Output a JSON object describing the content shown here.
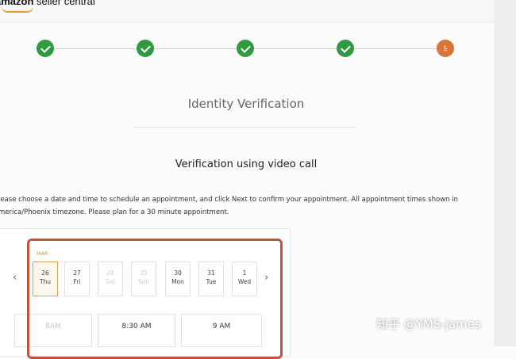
{
  "header": {
    "logo_brand": "amazon",
    "logo_rest": " seller central"
  },
  "steps": [
    {
      "state": "done",
      "icon": "check-icon"
    },
    {
      "state": "done",
      "icon": "check-icon"
    },
    {
      "state": "done",
      "icon": "check-icon"
    },
    {
      "state": "done",
      "icon": "check-icon"
    },
    {
      "state": "current",
      "label": "5"
    }
  ],
  "page": {
    "title": "Identity Verification",
    "subtitle": "Verification using video call",
    "instructions_line1": "lease choose a date and time to schedule an appointment, and click Next to confirm your appointment. All appointment times shown in",
    "instructions_line2": "merica/Phoenix timezone. Please plan for a 30 minute appointment."
  },
  "calendar": {
    "month": "MAR",
    "prev_icon": "chevron-left-icon",
    "next_icon": "chevron-right-icon",
    "days": [
      {
        "num": "26",
        "dow": "Thu",
        "state": "selected"
      },
      {
        "num": "27",
        "dow": "Fri",
        "state": "available"
      },
      {
        "num": "28",
        "dow": "Sat",
        "state": "disabled"
      },
      {
        "num": "29",
        "dow": "Sun",
        "state": "disabled"
      },
      {
        "num": "30",
        "dow": "Mon",
        "state": "available"
      },
      {
        "num": "31",
        "dow": "Tue",
        "state": "available"
      },
      {
        "num": "1",
        "dow": "Wed",
        "state": "available"
      }
    ],
    "slots": [
      {
        "label": "8AM",
        "state": "disabled"
      },
      {
        "label": "8:30 AM",
        "state": "available"
      },
      {
        "label": "9 AM",
        "state": "available"
      }
    ]
  },
  "watermark": "知乎 @YMS-james",
  "colors": {
    "step_done": "#2f9a42",
    "step_current": "#d9743a",
    "highlight": "#c5523a"
  }
}
